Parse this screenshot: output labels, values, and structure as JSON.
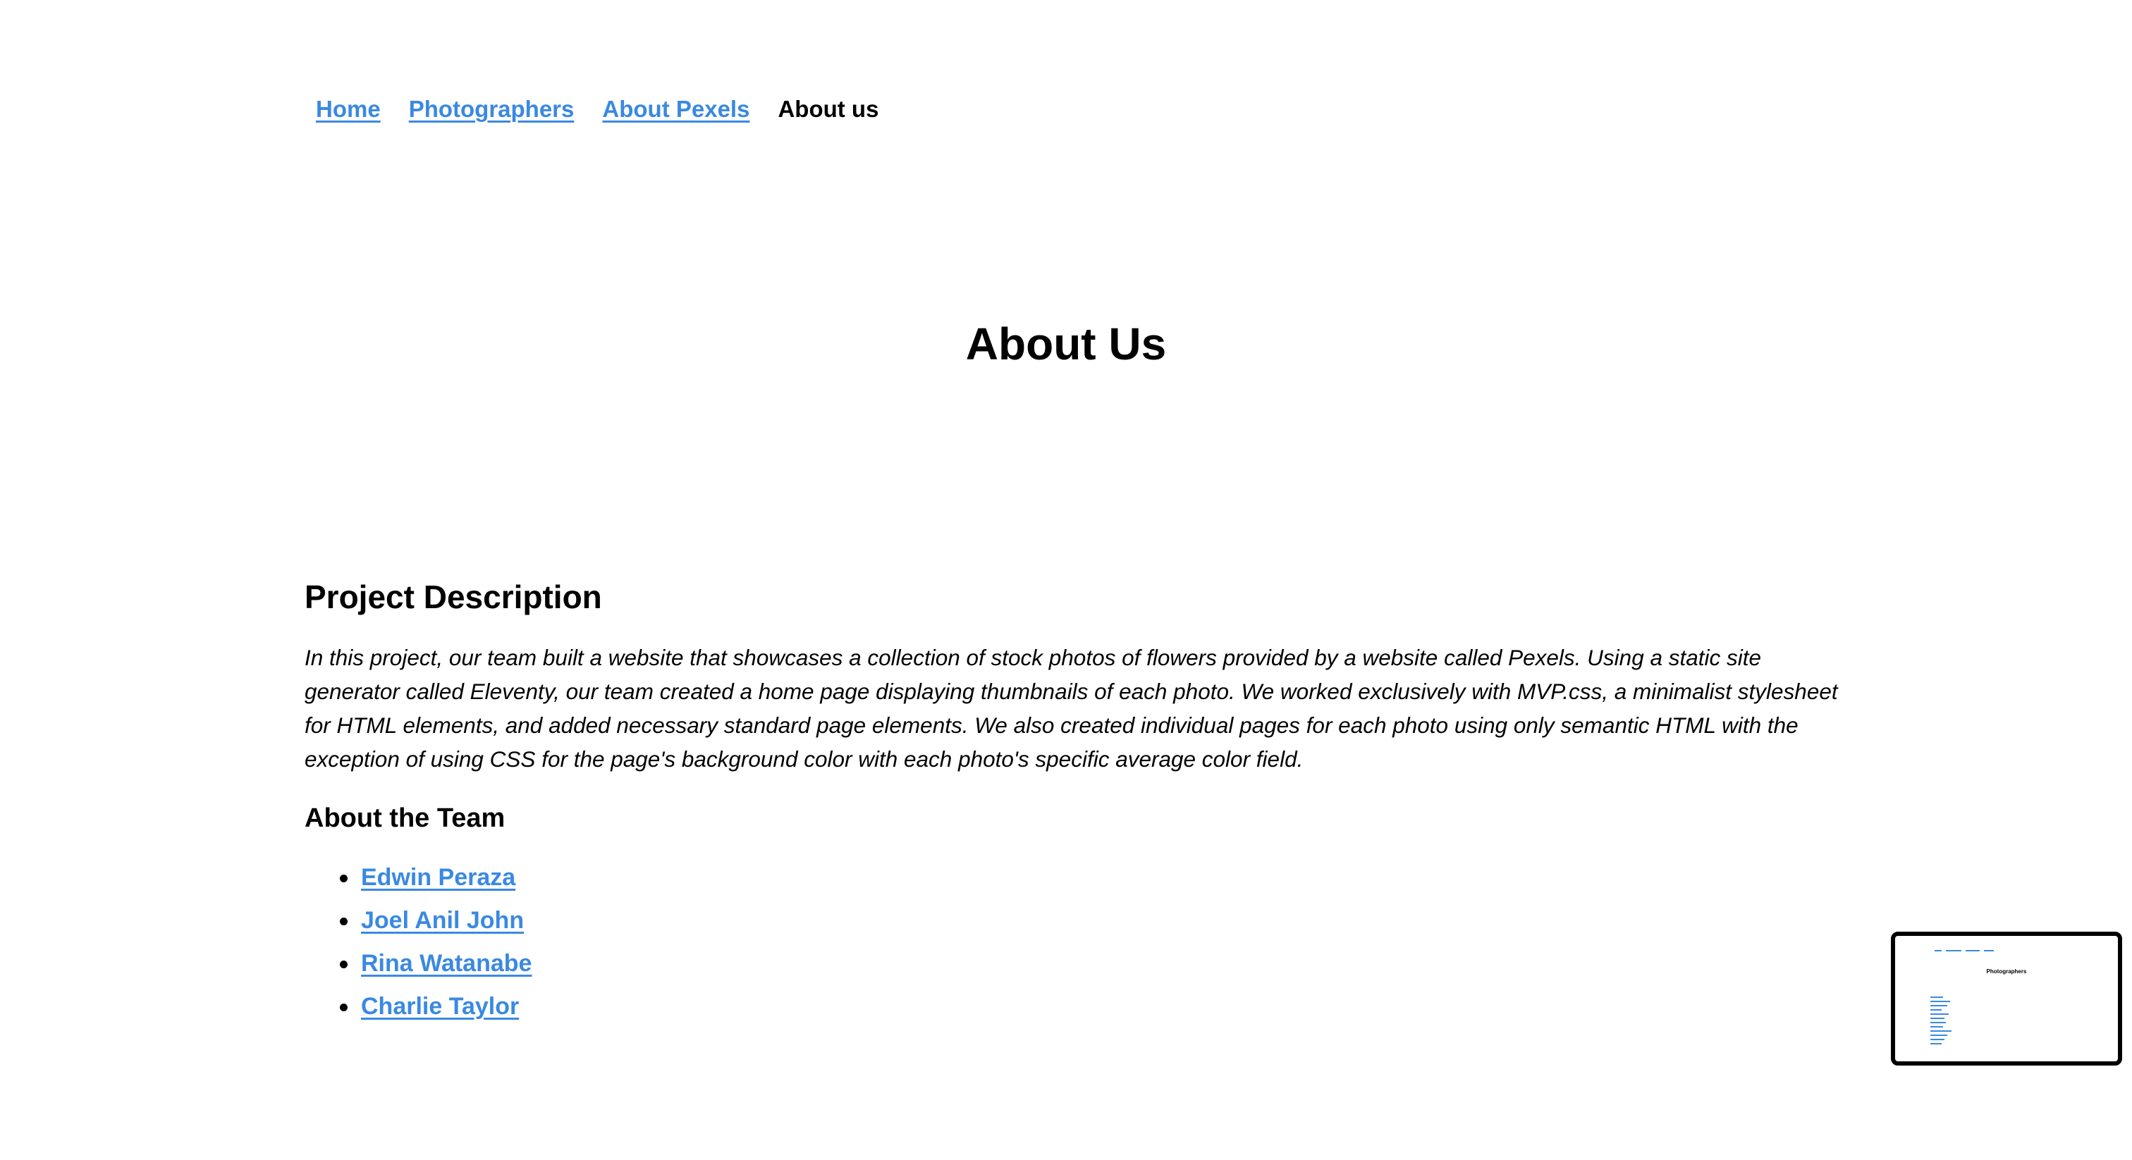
{
  "nav": {
    "items": [
      {
        "label": "Home"
      },
      {
        "label": "Photographers"
      },
      {
        "label": "About Pexels"
      },
      {
        "label": "About us"
      }
    ]
  },
  "hero": {
    "title": "About Us"
  },
  "project": {
    "heading": "Project Description",
    "description": "In this project, our team built a website that showcases a collection of stock photos of flowers provided by a website called Pexels. Using a static site generator called Eleventy, our team created a home page displaying thumbnails of each photo. We worked exclusively with MVP.css, a minimalist stylesheet for HTML elements, and added necessary standard page elements. We also created individual pages for each photo using only semantic HTML with the exception of using CSS for the page's background color with each photo's specific average color field."
  },
  "team": {
    "heading": "About the Team",
    "members": [
      {
        "name": "Edwin Peraza"
      },
      {
        "name": "Joel Anil John"
      },
      {
        "name": "Rina Watanabe"
      },
      {
        "name": "Charlie Taylor"
      }
    ]
  },
  "preview": {
    "title": "Photographers"
  },
  "colors": {
    "link": "#3a89e2",
    "text": "#000000",
    "background": "#ffffff"
  }
}
